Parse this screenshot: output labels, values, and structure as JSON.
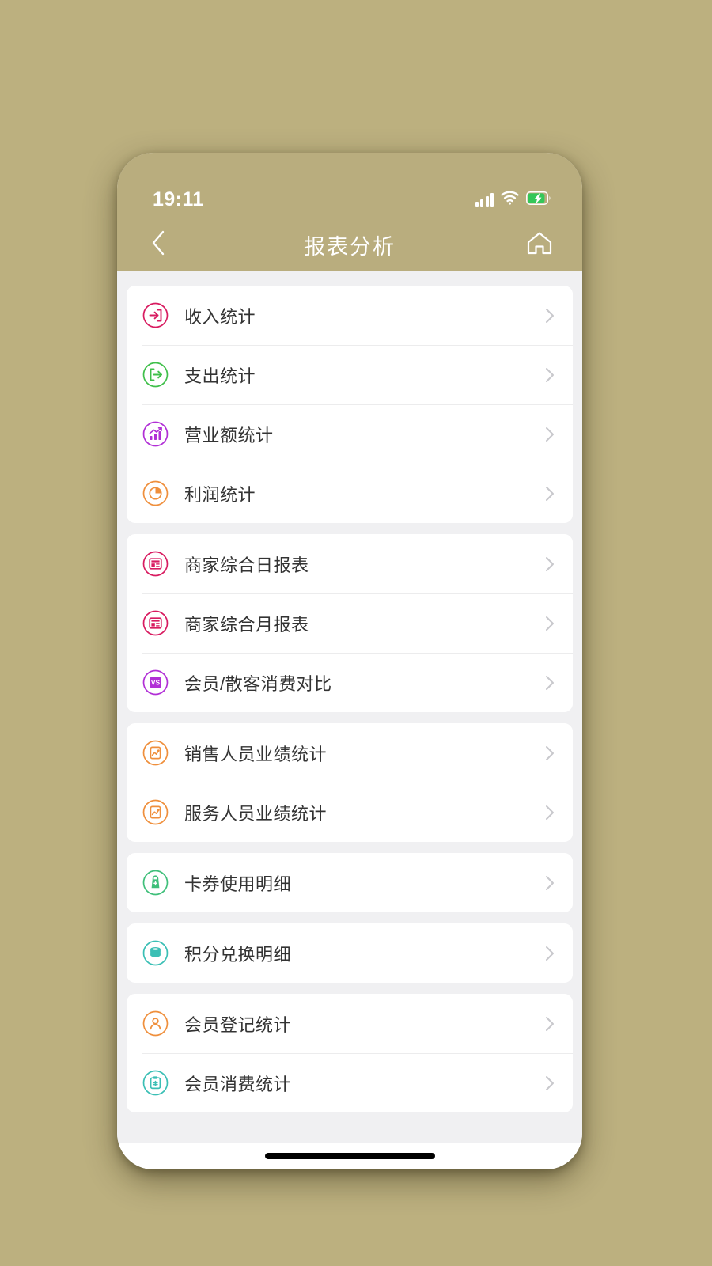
{
  "status_bar": {
    "time": "19:11",
    "signal_icon": "cellular-signal-icon",
    "wifi_icon": "wifi-icon",
    "battery_icon": "battery-charging-icon"
  },
  "nav_bar": {
    "back_icon": "chevron-left-icon",
    "title": "报表分析",
    "home_icon": "home-icon"
  },
  "colors": {
    "page_background": "#bcb07f",
    "header_background": "#b9ad7e",
    "content_background": "#f0f0f2",
    "card_background": "#ffffff",
    "label_text": "#333333",
    "chevron": "#c8c8cc",
    "crimson": "#d81b60",
    "green": "#3fbf4a",
    "purple": "#b12fd6",
    "orange": "#ef8f3c",
    "teal": "#3bbfb5",
    "mint": "#3fbf7a"
  },
  "groups": [
    {
      "name": "revenue-statistics-group",
      "items": [
        {
          "label": "收入统计",
          "icon": "income-login-arrow-icon",
          "color": "#d81b60"
        },
        {
          "label": "支出统计",
          "icon": "expense-logout-arrow-icon",
          "color": "#3fbf4a"
        },
        {
          "label": "营业额统计",
          "icon": "turnover-bar-chart-icon",
          "color": "#b12fd6"
        },
        {
          "label": "利润统计",
          "icon": "profit-pie-chart-icon",
          "color": "#ef8f3c"
        }
      ]
    },
    {
      "name": "merchant-reports-group",
      "items": [
        {
          "label": "商家综合日报表",
          "icon": "daily-report-icon",
          "color": "#d81b60"
        },
        {
          "label": "商家综合月报表",
          "icon": "monthly-report-icon",
          "color": "#d81b60"
        },
        {
          "label": "会员/散客消费对比",
          "icon": "member-vs-guest-icon",
          "color": "#b12fd6"
        }
      ]
    },
    {
      "name": "staff-performance-group",
      "items": [
        {
          "label": "销售人员业绩统计",
          "icon": "sales-performance-chart-icon",
          "color": "#ef8f3c"
        },
        {
          "label": "服务人员业绩统计",
          "icon": "service-performance-chart-icon",
          "color": "#ef8f3c"
        }
      ]
    },
    {
      "name": "coupon-usage-group",
      "items": [
        {
          "label": "卡券使用明细",
          "icon": "coupon-gift-bag-icon",
          "color": "#3fbf7a"
        }
      ]
    },
    {
      "name": "points-exchange-group",
      "items": [
        {
          "label": "积分兑换明细",
          "icon": "points-coins-stack-icon",
          "color": "#3bbfb5"
        }
      ]
    },
    {
      "name": "member-statistics-group",
      "items": [
        {
          "label": "会员登记统计",
          "icon": "member-register-person-icon",
          "color": "#ef8f3c"
        },
        {
          "label": "会员消费统计",
          "icon": "member-consumption-clipboard-icon",
          "color": "#3bbfb5"
        }
      ]
    }
  ],
  "home_indicator": "home-indicator-bar"
}
